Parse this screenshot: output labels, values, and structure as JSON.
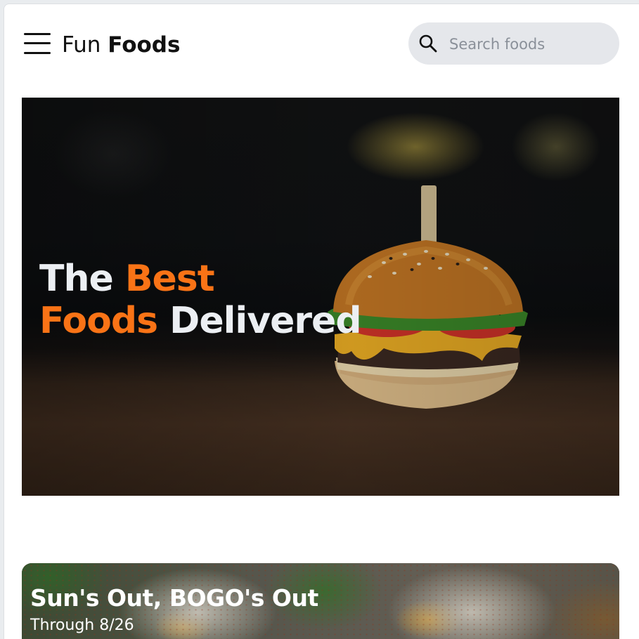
{
  "header": {
    "logo_light": "Fun",
    "logo_bold": "Foods",
    "search_placeholder": "Search foods"
  },
  "hero": {
    "title_line1_word1": "The",
    "title_line1_word2": "Best",
    "title_line2_word1": "Foods",
    "title_line2_word2": "Delivered",
    "accent_color": "#f97316"
  },
  "promo": {
    "title": "Sun's Out, BOGO's Out",
    "subtitle": "Through 8/26"
  },
  "icons": {
    "menu": "hamburger-menu-icon",
    "search": "search-icon"
  }
}
